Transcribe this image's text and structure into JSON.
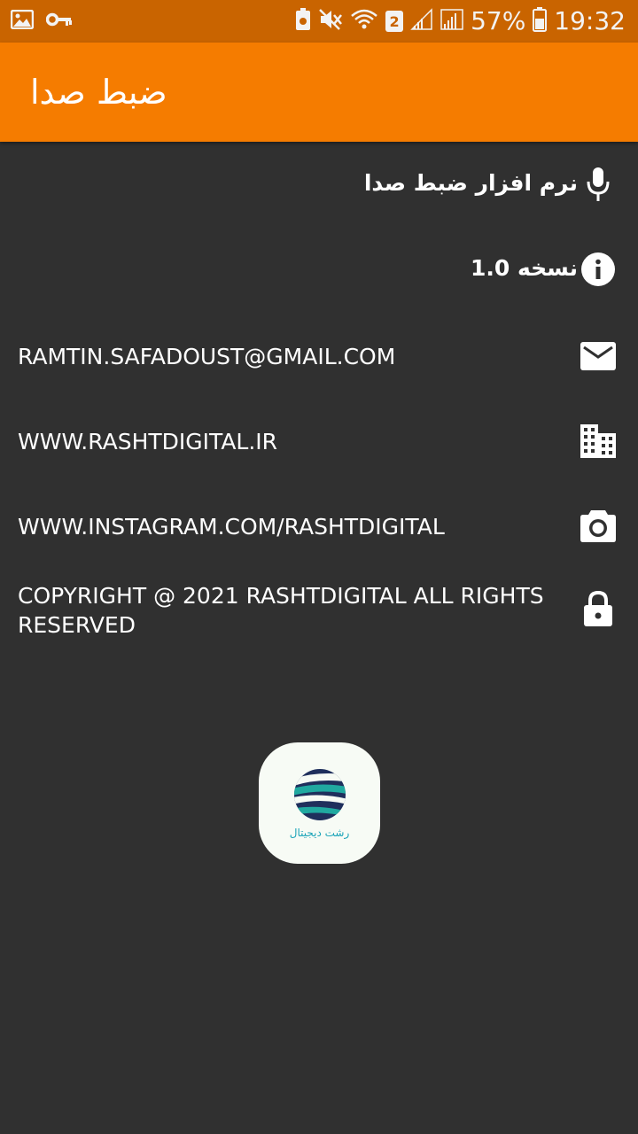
{
  "status_bar": {
    "sim_slot": "2",
    "battery": "57%",
    "time": "19:32"
  },
  "app_bar": {
    "title": "ضبط صدا"
  },
  "info": {
    "app_name": "نرم افزار ضبط صدا",
    "version": "نسخه 1.0",
    "email": "RAMTIN.SAFADOUST@GMAIL.COM",
    "website": "WWW.RASHTDIGITAL.IR",
    "instagram": "WWW.INSTAGRAM.COM/RASHTDIGITAL",
    "copyright_line1": "COPYRIGHT @ 2021 RASHTDIGITAL ALL RIGHTS",
    "copyright_line2": "RESERVED"
  },
  "logo": {
    "caption": "رشت دیجیتال"
  },
  "icons": {
    "app_name": "microphone-icon",
    "version": "info-icon",
    "email": "mail-icon",
    "website": "building-icon",
    "instagram": "camera-icon",
    "copyright": "lock-icon"
  },
  "colors": {
    "status_bar": "#c96400",
    "app_bar": "#f57c00",
    "background": "#303030",
    "text": "#ffffff"
  }
}
